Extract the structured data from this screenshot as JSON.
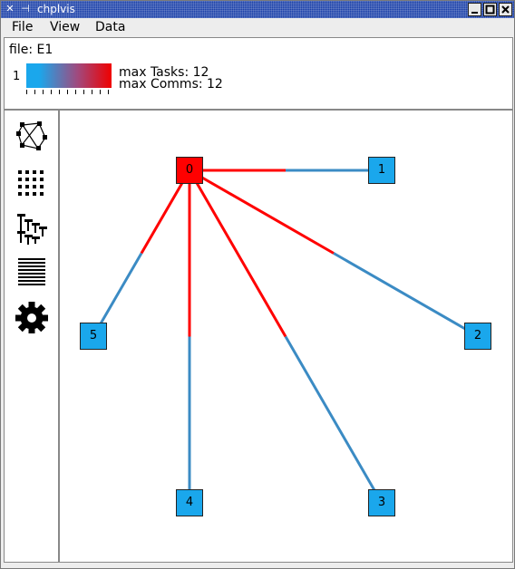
{
  "window": {
    "title": "chplvis"
  },
  "menubar": {
    "items": [
      "File",
      "View",
      "Data"
    ]
  },
  "info": {
    "file_label": "file: E1",
    "scale_min": "1",
    "max_tasks": "max Tasks: 12",
    "max_comms": "max Comms: 12"
  },
  "colors": {
    "hot": "#ff0000",
    "cold": "#1aa7ec",
    "edge_cold": "#3b8bc4"
  },
  "toolbar": {
    "tools": [
      "network-view-icon",
      "grid-view-icon",
      "tree-view-icon",
      "list-view-icon",
      "settings-gear-icon"
    ]
  },
  "graph": {
    "nodes": [
      {
        "id": "0",
        "hot": true
      },
      {
        "id": "1",
        "hot": false
      },
      {
        "id": "2",
        "hot": false
      },
      {
        "id": "3",
        "hot": false
      },
      {
        "id": "4",
        "hot": false
      },
      {
        "id": "5",
        "hot": false
      }
    ],
    "edges": [
      {
        "from": "0",
        "to": "1"
      },
      {
        "from": "0",
        "to": "2"
      },
      {
        "from": "0",
        "to": "3"
      },
      {
        "from": "0",
        "to": "4"
      },
      {
        "from": "0",
        "to": "5"
      }
    ]
  }
}
